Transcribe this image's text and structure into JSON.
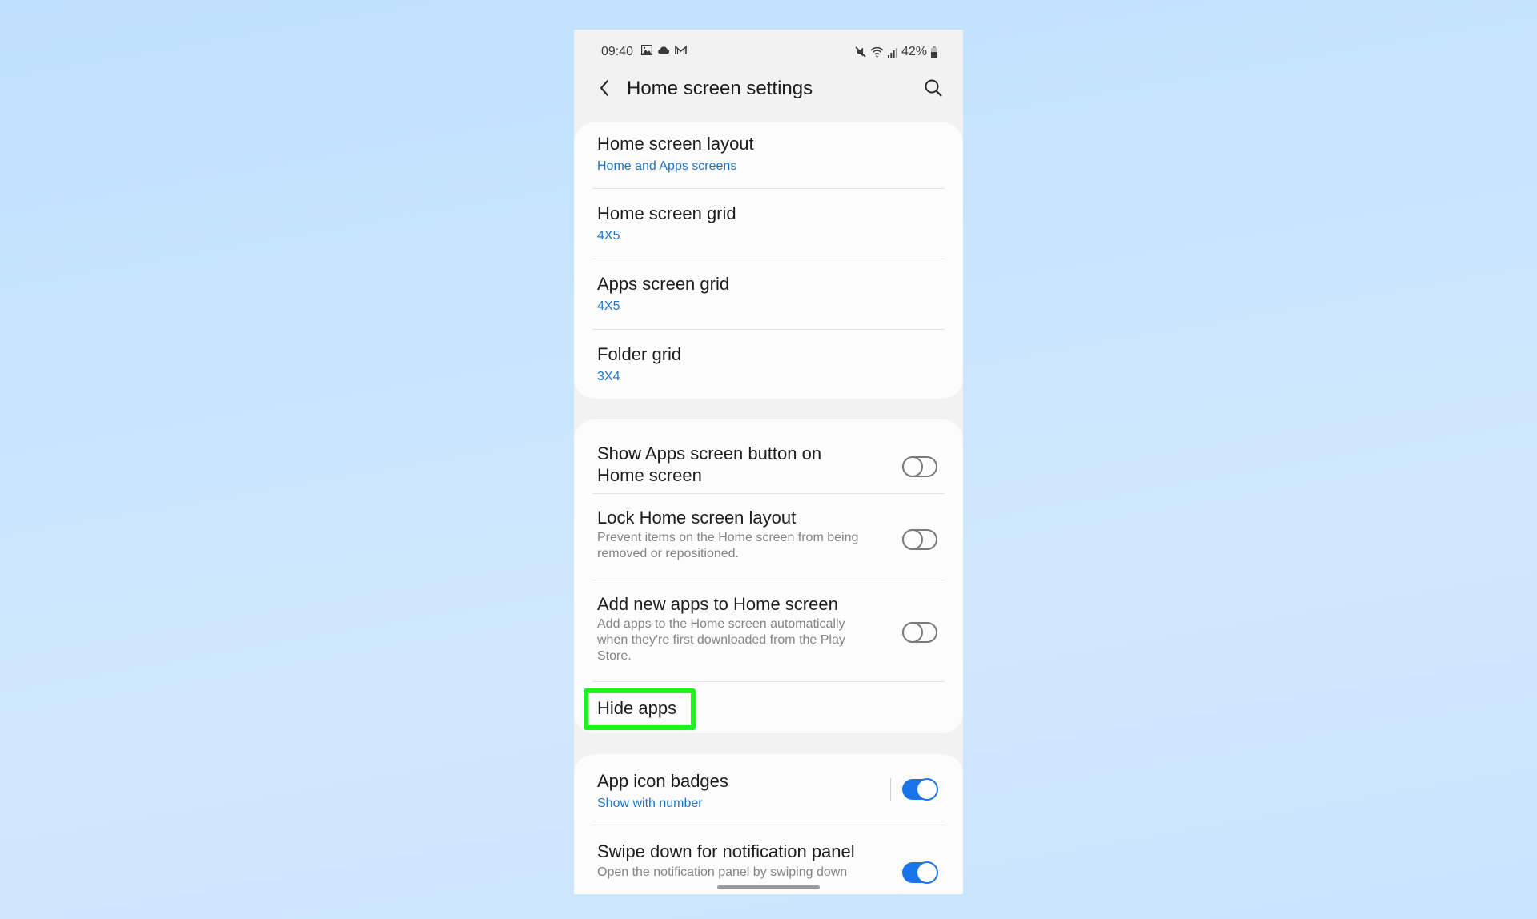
{
  "status_bar": {
    "time": "09:40",
    "left_icons": [
      "gallery-icon",
      "cloud-icon",
      "gmail-icon"
    ],
    "right_icons": [
      "mute-icon",
      "wifi-icon",
      "signal-icon"
    ],
    "battery": "42%"
  },
  "header": {
    "title": "Home screen settings",
    "back_icon": "chevron-left-icon",
    "search_icon": "search-icon"
  },
  "groups": [
    {
      "items": [
        {
          "title": "Home screen layout",
          "subtitle": "Home and Apps screens"
        },
        {
          "title": "Home screen grid",
          "subtitle": "4X5"
        },
        {
          "title": "Apps screen grid",
          "subtitle": "4X5"
        },
        {
          "title": "Folder grid",
          "subtitle": "3X4"
        }
      ]
    },
    {
      "items": [
        {
          "title_line1": "Show Apps screen button on",
          "title_line2": "Home screen",
          "toggle": false
        },
        {
          "title": "Lock Home screen layout",
          "subtitle_line1": "Prevent items on the Home screen from being",
          "subtitle_line2": "removed or repositioned.",
          "toggle": false
        },
        {
          "title": "Add new apps to Home screen",
          "subtitle_line1": "Add apps to the Home screen automatically",
          "subtitle_line2": "when they're first downloaded from the Play",
          "subtitle_line3": "Store.",
          "toggle": false
        },
        {
          "title": "Hide apps",
          "highlighted": true
        }
      ]
    },
    {
      "items": [
        {
          "title": "App icon badges",
          "subtitle": "Show with number",
          "toggle": true
        },
        {
          "title": "Swipe down for notification panel",
          "subtitle": "Open the notification panel by swiping down",
          "toggle": true
        }
      ]
    }
  ],
  "colors": {
    "accent": "#1a73e8",
    "subtitle_link": "#1c74c8",
    "highlight": "#1ef21e",
    "screen_bg": "#f2f2f2",
    "card_bg": "#fcfcfc"
  }
}
